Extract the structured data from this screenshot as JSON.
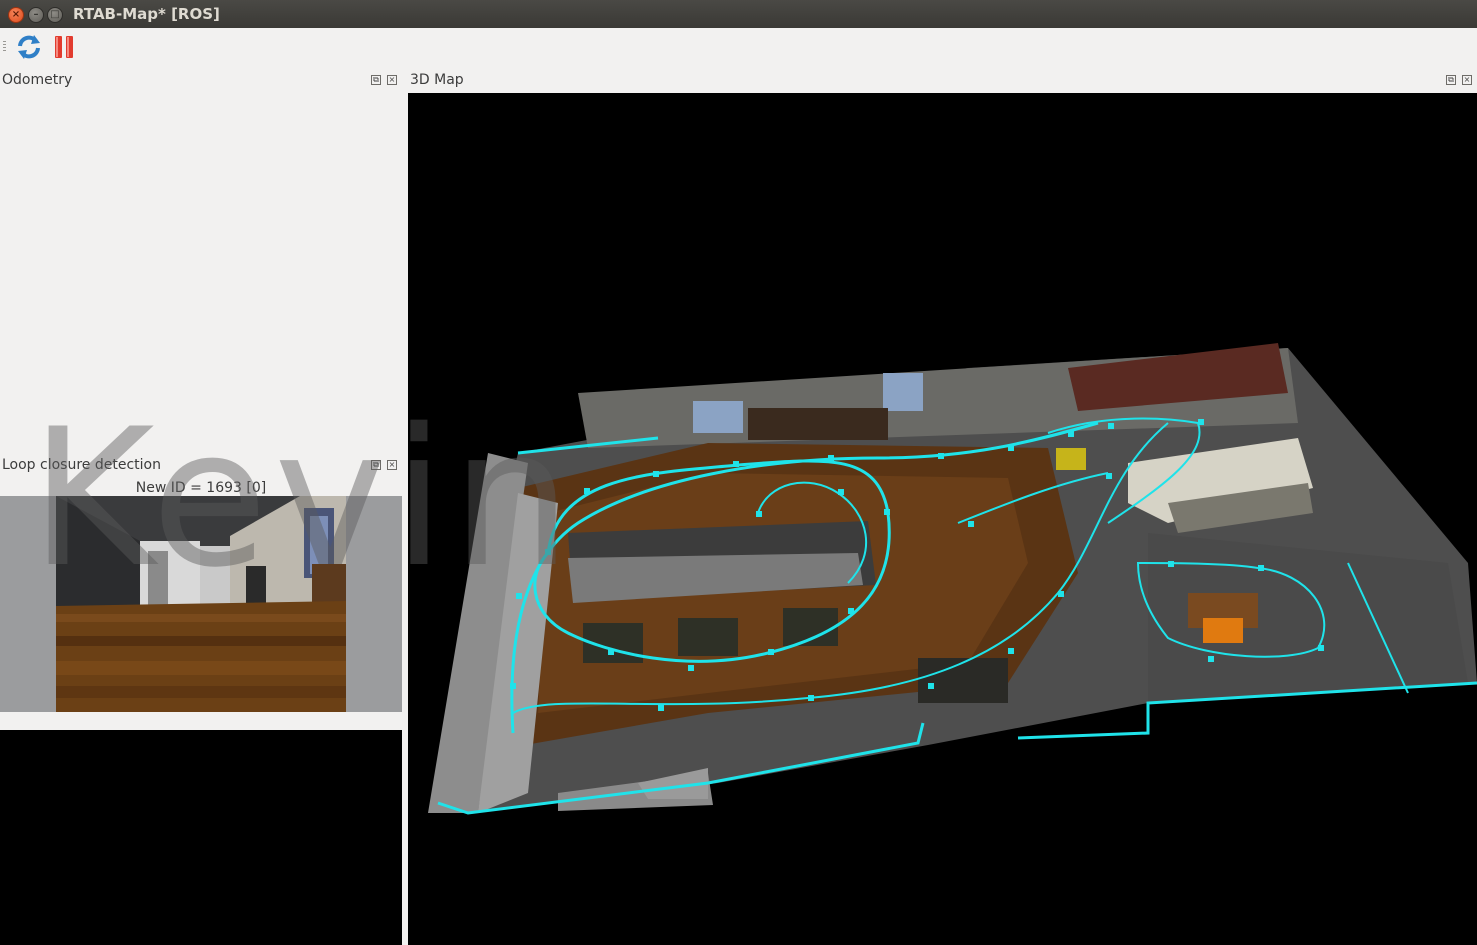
{
  "window": {
    "title": "RTAB-Map* [ROS]",
    "controls": [
      "close-icon",
      "minimize-icon",
      "maximize-icon"
    ]
  },
  "toolbar": {
    "buttons": [
      {
        "icon": "refresh-icon",
        "color": "#2f7fc7"
      },
      {
        "icon": "pause-icon",
        "color": "#e23b2e"
      }
    ]
  },
  "docks": {
    "odometry": {
      "title": "Odometry"
    },
    "loop_closure": {
      "title": "Loop closure detection",
      "status": "New ID = 1693 [0]"
    },
    "map3d": {
      "title": "3D Map"
    }
  },
  "watermark": "Kevin",
  "colors": {
    "trajectory": "#1fe3ea",
    "floor": "#5a3414",
    "walls": "#6e6e6e"
  }
}
